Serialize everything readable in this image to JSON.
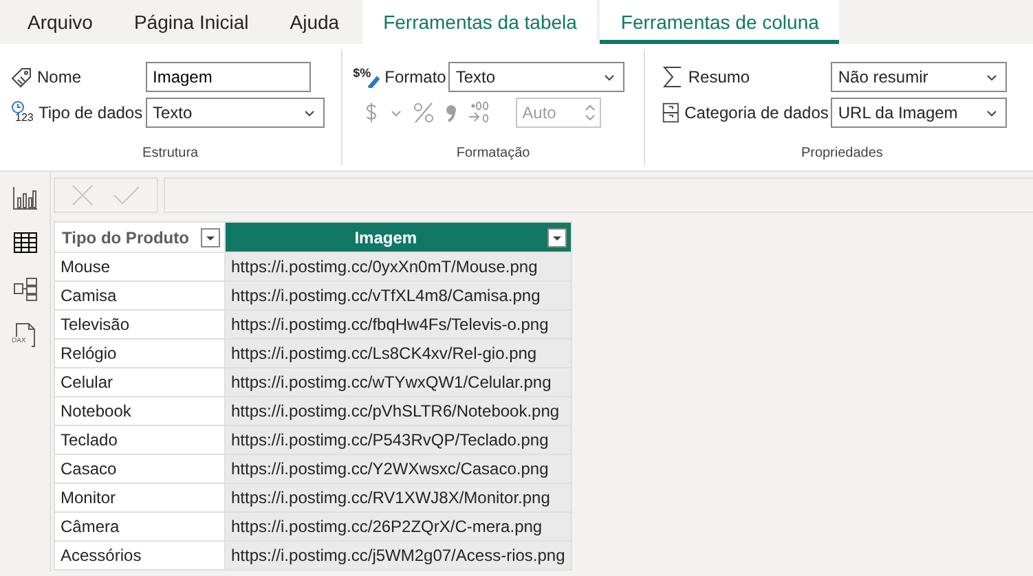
{
  "tabs": [
    {
      "label": "Arquivo",
      "kind": "standard",
      "selected": false
    },
    {
      "label": "Página Inicial",
      "kind": "standard",
      "selected": false
    },
    {
      "label": "Ajuda",
      "kind": "standard",
      "selected": false
    },
    {
      "label": "Ferramentas da tabela",
      "kind": "contextual",
      "selected": false
    },
    {
      "label": "Ferramentas de coluna",
      "kind": "contextual",
      "selected": true
    }
  ],
  "ribbon": {
    "groups": [
      {
        "label": "Estrutura",
        "kind": "estrutura",
        "name_label": "Nome",
        "name_value": "Imagem",
        "type_label": "Tipo de dados",
        "type_icon_text": "123",
        "type_value": "Texto"
      },
      {
        "label": "Formatação",
        "kind": "formatacao",
        "format_label": "Formato",
        "format_icon_text": "$%",
        "format_value": "Texto",
        "decimals_placeholder": "Auto",
        "disabled": true
      },
      {
        "label": "Propriedades",
        "kind": "propriedades",
        "summary_label": "Resumo",
        "summary_value": "Não resumir",
        "category_label": "Categoria de dados",
        "category_value": "URL da Imagem"
      }
    ]
  },
  "sidebar": {
    "items": [
      {
        "kind": "report",
        "selected": false
      },
      {
        "kind": "table",
        "selected": true
      },
      {
        "kind": "model",
        "selected": false
      },
      {
        "kind": "dax",
        "icon_text": "DAX",
        "selected": false
      }
    ]
  },
  "formula_bar": {
    "disabled": true
  },
  "table": {
    "columns": [
      {
        "label": "Tipo do Produto",
        "selected": false
      },
      {
        "label": "Imagem",
        "selected": true
      }
    ],
    "rows": [
      [
        "Mouse",
        "https://i.postimg.cc/0yxXn0mT/Mouse.png"
      ],
      [
        "Camisa",
        "https://i.postimg.cc/vTfXL4m8/Camisa.png"
      ],
      [
        "Televisão",
        "https://i.postimg.cc/fbqHw4Fs/Televis-o.png"
      ],
      [
        "Relógio",
        "https://i.postimg.cc/Ls8CK4xv/Rel-gio.png"
      ],
      [
        "Celular",
        "https://i.postimg.cc/wTYwxQW1/Celular.png"
      ],
      [
        "Notebook",
        "https://i.postimg.cc/pVhSLTR6/Notebook.png"
      ],
      [
        "Teclado",
        "https://i.postimg.cc/P543RvQP/Teclado.png"
      ],
      [
        "Casaco",
        "https://i.postimg.cc/Y2WXwsxc/Casaco.png"
      ],
      [
        "Monitor",
        "https://i.postimg.cc/RV1XWJ8X/Monitor.png"
      ],
      [
        "Câmera",
        "https://i.postimg.cc/26P2ZQrX/C-mera.png"
      ],
      [
        "Acessórios",
        "https://i.postimg.cc/j5WM2g07/Acess-rios.png"
      ]
    ]
  }
}
